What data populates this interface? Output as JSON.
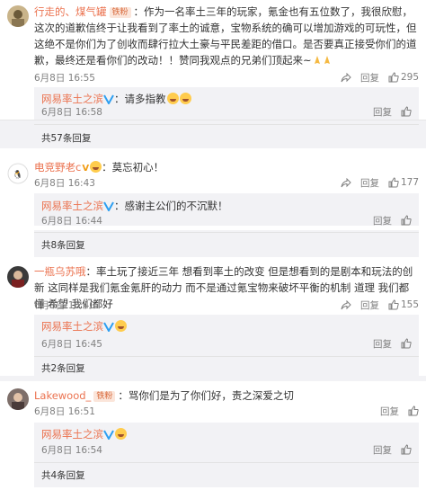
{
  "comments": [
    {
      "user": "行走的、煤气罐",
      "badge": "铁粉",
      "text": "：作为一名率土三年的玩家，氪金也有五位数了，我很欣慰，这次的道歉信终于让我看到了率土的诚意，宝物系统的确可以增加游戏的可玩性，但这绝不是你们为了创收而肆行拉大土豪与平民差距的借口。是否要真正接受你们的道歉，最终还是看你们的改动！！赞同我观点的兄弟们顶起来~",
      "time": "6月8日 16:55",
      "reply_label": "回复",
      "likes": "295",
      "reply": {
        "user": "网易率土之滨",
        "text": "：请多指教",
        "time": "6月8日 16:58",
        "reply_label": "回复"
      },
      "more": "共57条回复"
    },
    {
      "user": "电竞野老c",
      "text": "：莫忘初心！",
      "time": "6月8日 16:43",
      "reply_label": "回复",
      "likes": "177",
      "reply": {
        "user": "网易率土之滨",
        "text": "：感谢主公们的不沉默！",
        "time": "6月8日 16:44",
        "reply_label": "回复"
      },
      "more": "共8条回复"
    },
    {
      "user": "一瓶乌苏哦",
      "text": "：率土玩了接近三年 想看到率土的改变 但是想看到的是剧本和玩法的创新 这同样是我们氪金氪肝的动力 而不是通过氪宝物来破坏平衡的机制 道理 我们都懂 希望 我们都好",
      "time": "6月8日 16:40",
      "reply_label": "回复",
      "likes": "155",
      "reply": {
        "user": "网易率土之滨",
        "text": "",
        "time": "6月8日 16:45",
        "reply_label": "回复"
      },
      "more": "共2条回复"
    },
    {
      "user": "Lakewood_",
      "badge": "铁粉",
      "text": "：骂你们是为了你们好，责之深爱之切",
      "time": "6月8日 16:51",
      "reply_label": "回复",
      "likes": "",
      "reply": {
        "user": "网易率土之滨",
        "text": "",
        "time": "6月8日 16:54",
        "reply_label": "回复"
      },
      "more": "共4条回复"
    }
  ],
  "colors": {
    "username": "#eb7350",
    "verified": "#2e9ff1",
    "background": "#f2f2f5"
  },
  "icons": {
    "like": "thumbs-up-icon",
    "share": "share-icon",
    "verified": "verified-v-icon"
  }
}
